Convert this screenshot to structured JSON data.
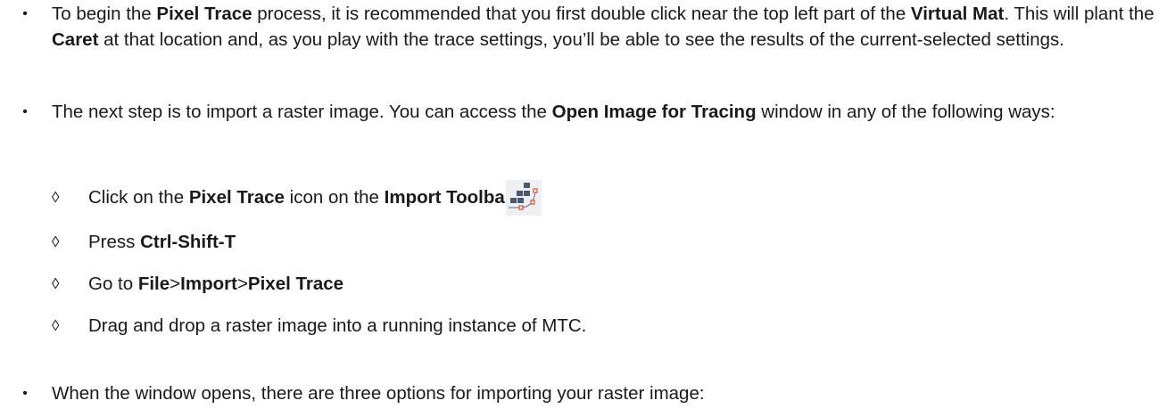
{
  "bullet_symbol": "•",
  "sub_bullet_symbol": "◊",
  "items": [
    {
      "segments": [
        {
          "t": "To begin the ",
          "b": false
        },
        {
          "t": "Pixel Trace",
          "b": true
        },
        {
          "t": " process, it is recommended that you first double click near the top left part of the ",
          "b": false
        },
        {
          "t": "Virtual Mat",
          "b": true
        },
        {
          "t": ". This will plant the ",
          "b": false
        },
        {
          "t": "Caret",
          "b": true
        },
        {
          "t": " at that location and, as you play with the trace settings, you’ll be able to see the results of the current-selected settings.",
          "b": false
        }
      ]
    },
    {
      "segments": [
        {
          "t": "The next step is to import a raster image. You can access the ",
          "b": false
        },
        {
          "t": "Open Image for Tracing",
          "b": true
        },
        {
          "t": " window in any of the following ways:",
          "b": false
        }
      ]
    },
    {
      "segments": [
        {
          "t": "When the window opens, there are three options for importing your raster image:",
          "b": false
        }
      ]
    }
  ],
  "sub_items": [
    {
      "segments": [
        {
          "t": "Click on the ",
          "b": false
        },
        {
          "t": "Pixel Trace",
          "b": true
        },
        {
          "t": " icon on the ",
          "b": false
        },
        {
          "t": "Import Toolbar",
          "b": true
        }
      ],
      "icon": "pixel-trace-icon"
    },
    {
      "segments": [
        {
          "t": "Press ",
          "b": false
        },
        {
          "t": "Ctrl-Shift-T",
          "b": true
        }
      ]
    },
    {
      "segments": [
        {
          "t": "Go to ",
          "b": false
        },
        {
          "t": "File",
          "b": true
        },
        {
          "t": ">",
          "b": false
        },
        {
          "t": "Import",
          "b": true
        },
        {
          "t": ">",
          "b": false
        },
        {
          "t": "Pixel Trace",
          "b": true
        }
      ]
    },
    {
      "segments": [
        {
          "t": "Drag and drop a raster image into a running instance of MTC.",
          "b": false
        }
      ]
    }
  ],
  "colors": {
    "text": "#1a1a1a",
    "icon_square": "#4a5a6e",
    "icon_handle": "#e04a2a",
    "icon_bg": "#eef0f3"
  }
}
